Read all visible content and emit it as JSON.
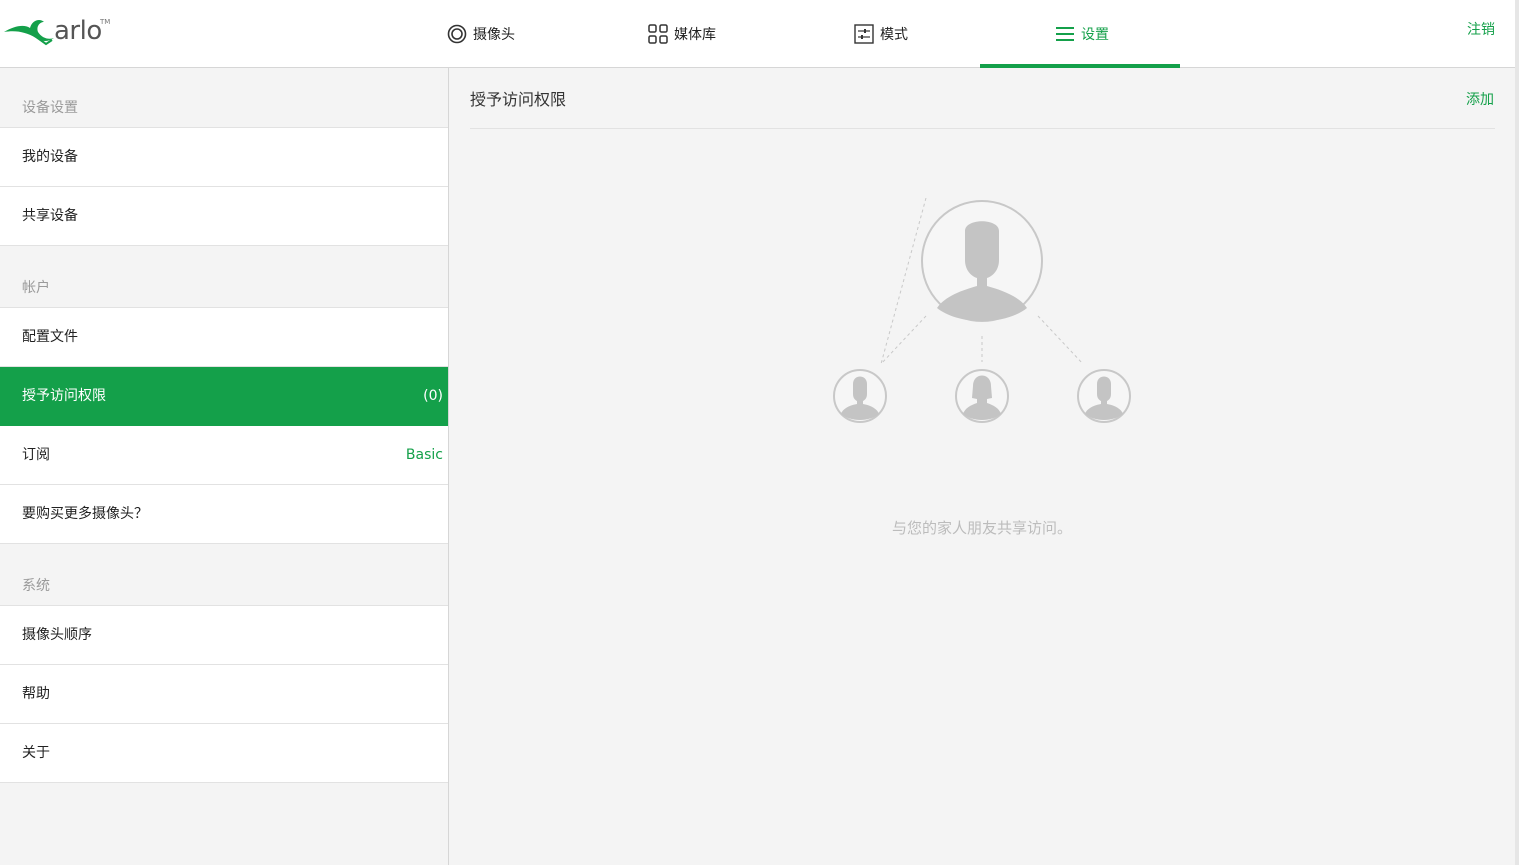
{
  "brand": {
    "logo_text": "arlo",
    "tm": "TM",
    "accent": "#14a04a"
  },
  "nav": {
    "tabs": [
      {
        "label": "摄像头",
        "icon": "camera-ring-icon"
      },
      {
        "label": "媒体库",
        "icon": "grid-icon"
      },
      {
        "label": "模式",
        "icon": "sliders-icon"
      },
      {
        "label": "设置",
        "icon": "menu-icon",
        "active": true
      }
    ],
    "logout_label": "注销"
  },
  "sidebar": {
    "device_settings": {
      "heading": "设备设置",
      "items": [
        {
          "label": "我的设备"
        },
        {
          "label": "共享设备"
        }
      ]
    },
    "account": {
      "heading": "帐户",
      "items": [
        {
          "label": "配置文件"
        },
        {
          "label": "授予访问权限",
          "value": "(0)",
          "active": true
        },
        {
          "label": "订阅",
          "value": "Basic"
        },
        {
          "label": "要购买更多摄像头？"
        }
      ]
    },
    "system": {
      "heading": "系统",
      "items": [
        {
          "label": "摄像头顺序"
        },
        {
          "label": "帮助"
        },
        {
          "label": "关于"
        }
      ]
    }
  },
  "main": {
    "title": "授予访问权限",
    "add_label": "添加",
    "empty_message": "与您的家人朋友共享访问。"
  }
}
